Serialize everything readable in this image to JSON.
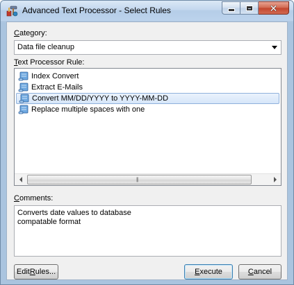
{
  "window": {
    "title": "Advanced Text Processor - Select Rules",
    "icon": "app-hammer-icon"
  },
  "category": {
    "label_accel": "C",
    "label_rest": "ategory:",
    "selected": "Data file cleanup"
  },
  "rules": {
    "label_accel": "T",
    "label_rest": "ext Processor Rule:",
    "items": [
      {
        "label": "Index Convert",
        "selected": false
      },
      {
        "label": "Extract E-Mails",
        "selected": false
      },
      {
        "label": "Convert MM/DD/YYYY to YYYY-MM-DD",
        "selected": true
      },
      {
        "label": "Replace multiple spaces with one",
        "selected": false
      }
    ]
  },
  "comments": {
    "label_accel": "C",
    "label_rest": "omments:",
    "text": "Converts date values to database\ncompatable format"
  },
  "buttons": {
    "edit_rules": {
      "pre": "Edit ",
      "accel": "R",
      "post": "ules..."
    },
    "execute": {
      "pre": "",
      "accel": "E",
      "post": "xecute"
    },
    "cancel": {
      "pre": "",
      "accel": "C",
      "post": "ancel"
    }
  },
  "colors": {
    "selection_fill": "#d6e6f9",
    "selection_border": "#8fb1dc",
    "close_button": "#c2452d"
  }
}
